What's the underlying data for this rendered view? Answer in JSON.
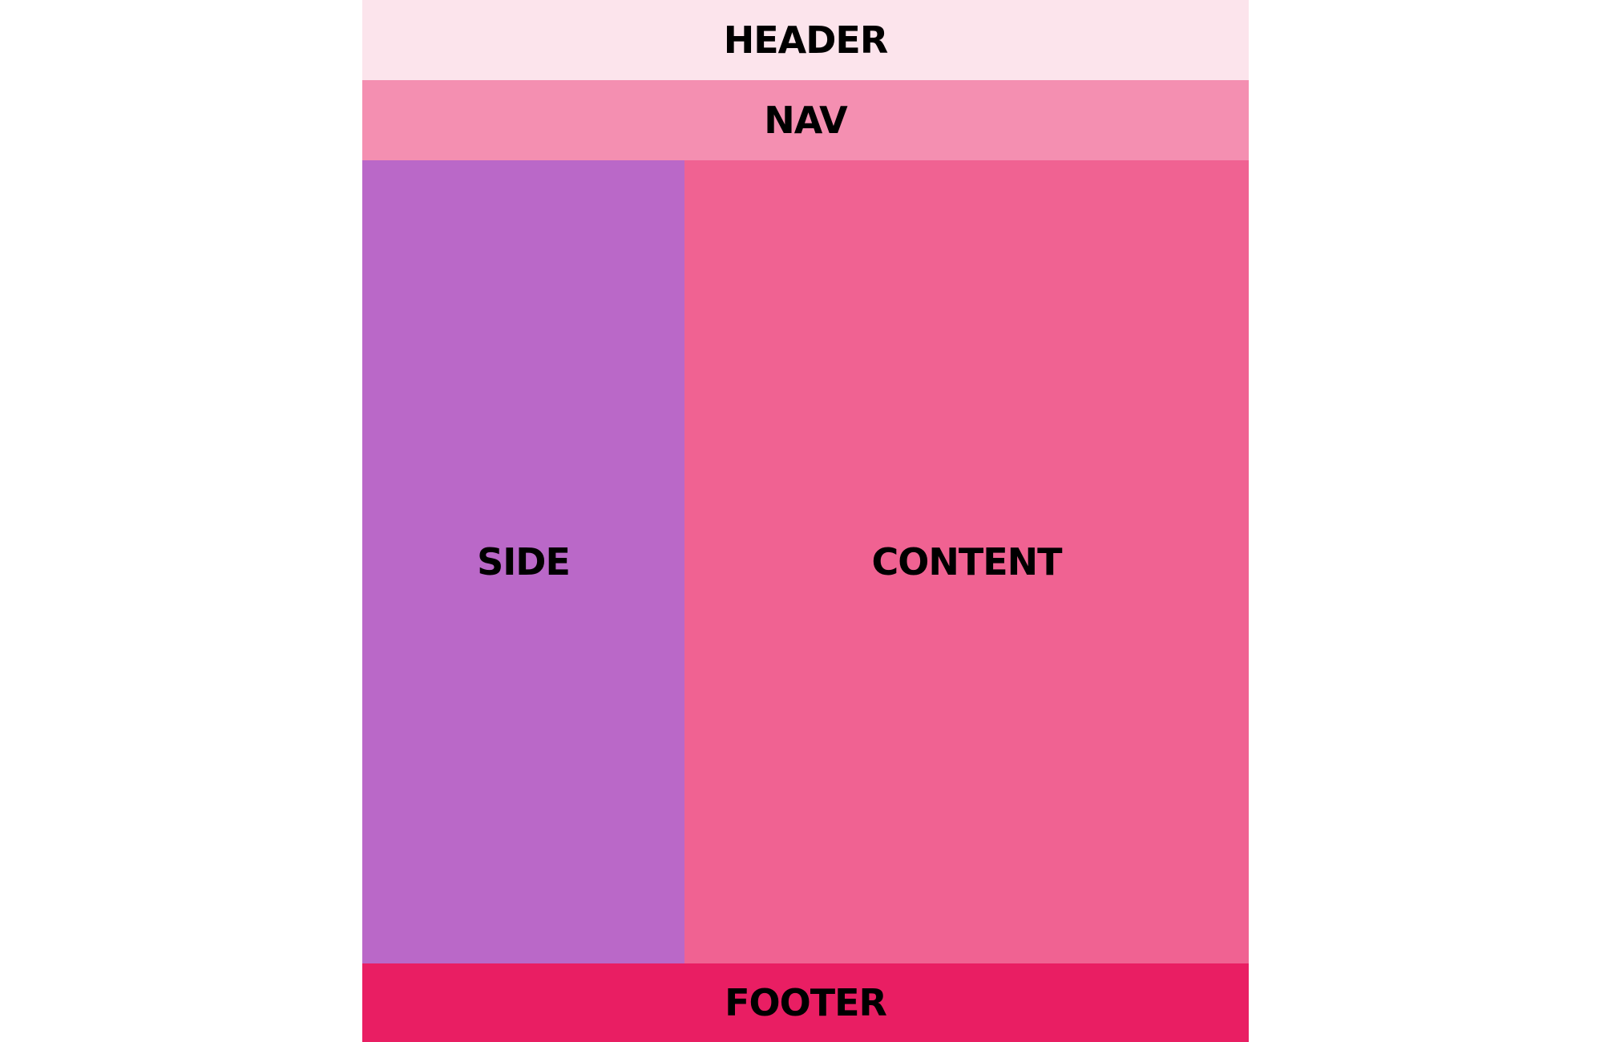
{
  "layout": {
    "header": {
      "label": "HEADER",
      "color": "#FCE4EC"
    },
    "nav": {
      "label": "NAV",
      "color": "#F48FB1"
    },
    "side": {
      "label": "SIDE",
      "color": "#BA68C8"
    },
    "content": {
      "label": "CONTENT",
      "color": "#F06292"
    },
    "footer": {
      "label": "FOOTER",
      "color": "#E91E63"
    }
  }
}
